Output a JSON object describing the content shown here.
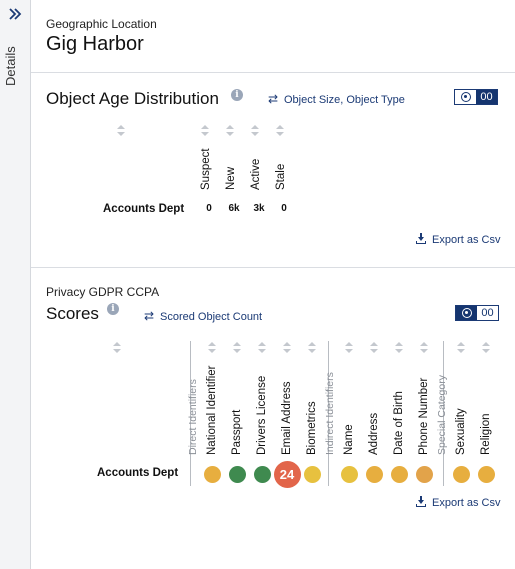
{
  "rail": {
    "label": "Details",
    "expand_icon": "double-chevron-right-icon"
  },
  "location": {
    "label": "Geographic Location",
    "value": "Gig Harbor"
  },
  "age": {
    "title": "Object Age Distribution",
    "switch_links": [
      "Object Size",
      "Object Type"
    ],
    "switch_separator": ",",
    "toggle_value": "00",
    "columns": [
      "Suspect",
      "New",
      "Active",
      "Stale"
    ],
    "rows": [
      {
        "label": "Accounts Dept",
        "values": [
          "0",
          "6k",
          "3k",
          "0"
        ]
      }
    ],
    "export_label": "Export as Csv"
  },
  "scores": {
    "subtitle": "Privacy GDPR CCPA",
    "title": "Scores",
    "switch_link": "Scored Object Count",
    "toggle_value": "00",
    "groups": [
      "Direct Identifiers",
      "Indirect Identifiers",
      "Special Category"
    ],
    "columns": [
      {
        "label": "National Identifier",
        "color": "#e7ae3f",
        "value": ""
      },
      {
        "label": "Passport",
        "color": "#3f8a4f",
        "value": ""
      },
      {
        "label": "Drivers License",
        "color": "#3f8a4f",
        "value": ""
      },
      {
        "label": "Email Address",
        "color": "#e2654a",
        "value": "24"
      },
      {
        "label": "Biometrics",
        "color": "#e7c13f",
        "value": ""
      },
      {
        "label": "Name",
        "color": "#e7c13f",
        "value": ""
      },
      {
        "label": "Address",
        "color": "#e7ae3f",
        "value": ""
      },
      {
        "label": "Date of Birth",
        "color": "#e7ae3f",
        "value": ""
      },
      {
        "label": "Phone Number",
        "color": "#e2a34a",
        "value": ""
      },
      {
        "label": "Sexuality",
        "color": "#e7ae3f",
        "value": ""
      },
      {
        "label": "Religion",
        "color": "#e7ae3f",
        "value": ""
      }
    ],
    "row_label": "Accounts Dept",
    "export_label": "Export as Csv"
  }
}
